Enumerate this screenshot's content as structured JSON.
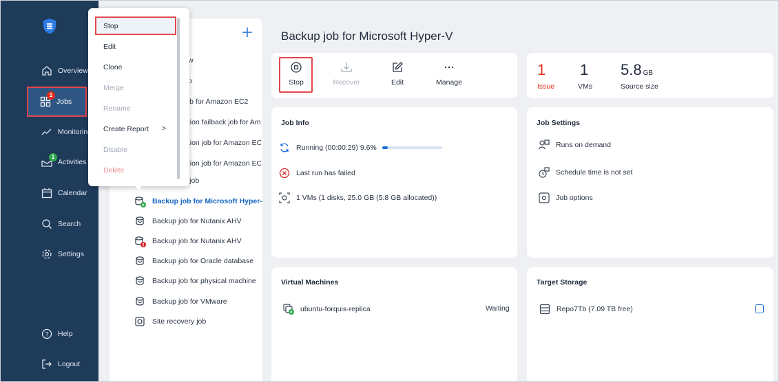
{
  "sidebar": {
    "items": [
      {
        "label": "Overview",
        "icon": "home-icon"
      },
      {
        "label": "Jobs",
        "icon": "jobs-icon",
        "badge": "1"
      },
      {
        "label": "Monitoring",
        "icon": "monitoring-icon"
      },
      {
        "label": "Activities",
        "icon": "activities-icon",
        "badge": "1"
      },
      {
        "label": "Calendar",
        "icon": "calendar-icon"
      },
      {
        "label": "Search",
        "icon": "search-icon"
      },
      {
        "label": "Settings",
        "icon": "settings-icon"
      },
      {
        "label": "Help",
        "icon": "help-icon"
      },
      {
        "label": "Logout",
        "icon": "logout-icon"
      }
    ]
  },
  "context_menu": {
    "items": [
      {
        "label": "Stop",
        "state": "highlighted"
      },
      {
        "label": "Edit",
        "state": "enabled"
      },
      {
        "label": "Clone",
        "state": "enabled"
      },
      {
        "label": "Merge",
        "state": "disabled"
      },
      {
        "label": "Rename",
        "state": "disabled"
      },
      {
        "label": "Create Report",
        "state": "enabled",
        "submenu": ">"
      },
      {
        "label": "Disable",
        "state": "disabled"
      },
      {
        "label": "Delete",
        "state": "danger-disabled"
      }
    ]
  },
  "job_list": {
    "rows": [
      {
        "label": "w"
      },
      {
        "label": "up"
      },
      {
        "label": "job for Amazon EC2"
      },
      {
        "label": "ation failback job for Am"
      },
      {
        "label": "ation job for Amazon EC"
      },
      {
        "label": "ation job for Amazon EC"
      },
      {
        "label": "y job"
      },
      {
        "label": "Backup job for Microsoft Hyper-V",
        "selected": true,
        "status": "running"
      },
      {
        "label": "Backup job for Nutanix AHV"
      },
      {
        "label": "Backup job for Nutanix AHV",
        "status": "failed"
      },
      {
        "label": "Backup job for Oracle database"
      },
      {
        "label": "Backup job for physical machine"
      },
      {
        "label": "Backup job for VMware"
      },
      {
        "label": "Site recovery job"
      }
    ]
  },
  "page": {
    "title": "Backup job for Microsoft Hyper-V"
  },
  "toolbar": {
    "stop": "Stop",
    "recover": "Recover",
    "edit": "Edit",
    "manage": "Manage"
  },
  "stats": {
    "issue_value": "1",
    "issue_label": "Issue",
    "vms_value": "1",
    "vms_label": "VMs",
    "size_value": "5.8",
    "size_unit": "GB",
    "size_label": "Source size"
  },
  "job_info": {
    "title": "Job Info",
    "running": "Running (00:00:29)  9.6%",
    "progress_fraction": 0.096,
    "last_run": "Last run has failed",
    "vms": "1 VMs (1 disks, 25.0 GB (5.8 GB allocated))"
  },
  "job_settings": {
    "title": "Job Settings",
    "runs": "Runs on demand",
    "schedule": "Schedule time is not set",
    "options": "Job options"
  },
  "virtual_machines": {
    "title": "Virtual Machines",
    "vm_name": "ubuntu-forquis-replica",
    "vm_status": "Waiting"
  },
  "target_storage": {
    "title": "Target Storage",
    "repo": "Repo7Tb (7.09 TB free)"
  },
  "colors": {
    "sidebar": "#1f3b5a",
    "accent": "#1e6fd9",
    "danger": "#e0301e",
    "highlight_border": "#e2474c"
  }
}
